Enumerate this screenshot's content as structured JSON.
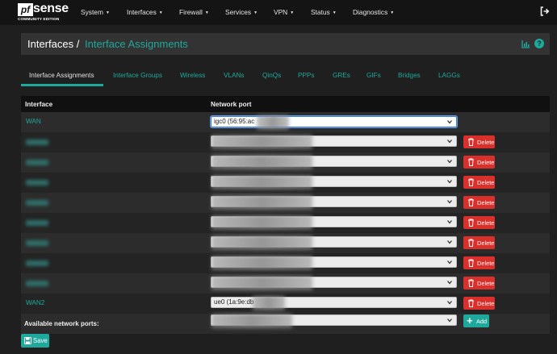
{
  "brand": {
    "mark": "pf",
    "name": "sense",
    "edition": "COMMUNITY EDITION"
  },
  "nav": {
    "items": [
      {
        "label": "System"
      },
      {
        "label": "Interfaces"
      },
      {
        "label": "Firewall"
      },
      {
        "label": "Services"
      },
      {
        "label": "VPN"
      },
      {
        "label": "Status"
      },
      {
        "label": "Diagnostics"
      }
    ],
    "logout_icon": "sign-out-icon"
  },
  "breadcrumb": {
    "root": "Interfaces",
    "separator": "/",
    "current": "Interface Assignments"
  },
  "header_icons": [
    "chart-icon",
    "help-icon"
  ],
  "tabs": [
    {
      "label": "Interface Assignments",
      "active": true
    },
    {
      "label": "Interface Groups"
    },
    {
      "label": "Wireless"
    },
    {
      "label": "VLANs"
    },
    {
      "label": "QinQs"
    },
    {
      "label": "PPPs"
    },
    {
      "label": "GREs"
    },
    {
      "label": "GIFs"
    },
    {
      "label": "Bridges"
    },
    {
      "label": "LAGGs"
    }
  ],
  "table": {
    "headers": {
      "interface": "Interface",
      "network_port": "Network port"
    },
    "rows": [
      {
        "interface": "WAN",
        "port": "igc0 (56:95:ac",
        "deletable": false
      },
      {
        "interface": "",
        "port": "",
        "deletable": true
      },
      {
        "interface": "",
        "port": "",
        "deletable": true
      },
      {
        "interface": "",
        "port": "",
        "deletable": true
      },
      {
        "interface": "",
        "port": "",
        "deletable": true
      },
      {
        "interface": "",
        "port": "",
        "deletable": true
      },
      {
        "interface": "",
        "port": "",
        "deletable": true
      },
      {
        "interface": "",
        "port": "",
        "deletable": true
      },
      {
        "interface": "",
        "port": "",
        "deletable": true
      },
      {
        "interface": "WAN2",
        "port": "ue0 (1a:9e:db",
        "deletable": true
      }
    ],
    "delete_label": "Delete",
    "available_label": "Available network ports:",
    "add_label": "Add"
  },
  "save_label": "Save",
  "colors": {
    "accent": "#1fa89c",
    "danger": "#d9302b",
    "background": "#1f1f1f"
  }
}
